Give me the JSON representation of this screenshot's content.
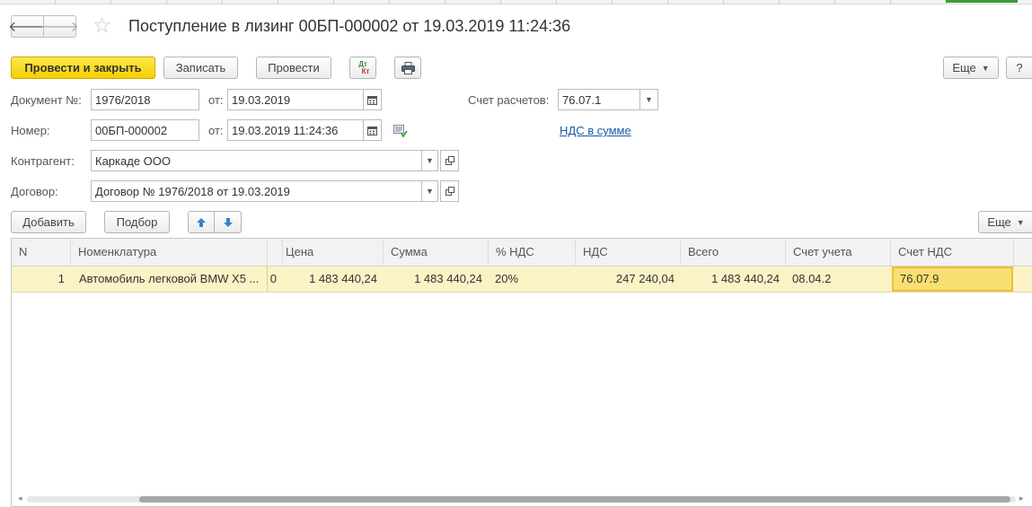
{
  "window": {
    "title": "Поступление в лизинг 00БП-000002 от 19.03.2019 11:24:36"
  },
  "nav": {
    "back_icon": "arrow-left-icon",
    "forward_icon": "arrow-right-icon",
    "favorite_icon": "star-icon"
  },
  "toolbar": {
    "post_close_label": "Провести и закрыть",
    "save_label": "Записать",
    "post_label": "Провести",
    "dtkt_icon": "debit-credit-icon",
    "dtkt_top": "Дт",
    "dtkt_bottom": "Кт",
    "print_icon": "printer-icon",
    "more_label": "Еще",
    "help_label": "?"
  },
  "form": {
    "doc_no_label": "Документ №:",
    "doc_no_value": "1976/2018",
    "from_label": "от:",
    "doc_date_value": "19.03.2019",
    "account_label": "Счет расчетов:",
    "account_value": "76.07.1",
    "number_label": "Номер:",
    "number_value": "00БП-000002",
    "number_date_value": "19.03.2019 11:24:36",
    "vat_link": "НДС в сумме",
    "counterparty_label": "Контрагент:",
    "counterparty_value": "Каркаде ООО",
    "contract_label": "Договор:",
    "contract_value": "Договор № 1976/2018 от 19.03.2019"
  },
  "table_toolbar": {
    "add_label": "Добавить",
    "pick_label": "Подбор",
    "more_label": "Еще"
  },
  "table": {
    "columns": [
      "N",
      "Номенклатура",
      "Цена",
      "Сумма",
      "% НДС",
      "НДС",
      "Всего",
      "Счет учета",
      "Счет НДС"
    ],
    "rows": [
      {
        "n": "1",
        "item": "Автомобиль легковой BMW X5 ...",
        "qty_fragment": "0",
        "price": "1 483 440,24",
        "sum": "1 483 440,24",
        "vat_rate": "20%",
        "vat": "247 240,04",
        "total": "1 483 440,24",
        "account": "08.04.2",
        "vat_account": "76.07.9"
      }
    ]
  }
}
